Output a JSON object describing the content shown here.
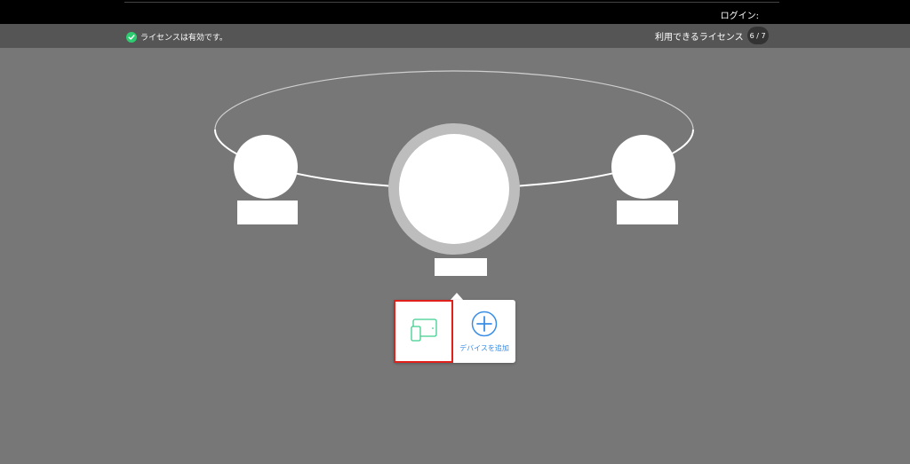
{
  "header": {
    "login_label": "ログイン:"
  },
  "status": {
    "license_valid_text": "ライセンスは有効です。",
    "available_licenses_label": "利用できるライセンス",
    "available_licenses_count": "6 / 7"
  },
  "popover": {
    "add_device_label": "デバイスを追加"
  },
  "icons": {
    "check": "check-circle-icon",
    "devices": "devices-icon",
    "add": "plus-circle-icon"
  },
  "colors": {
    "background": "#777777",
    "topbar": "#000000",
    "statusbar": "#555555",
    "check_green": "#2ecc71",
    "device_icon_green": "#3ecf8e",
    "add_blue": "#3a8ee6",
    "highlight_red": "#e0201b"
  }
}
